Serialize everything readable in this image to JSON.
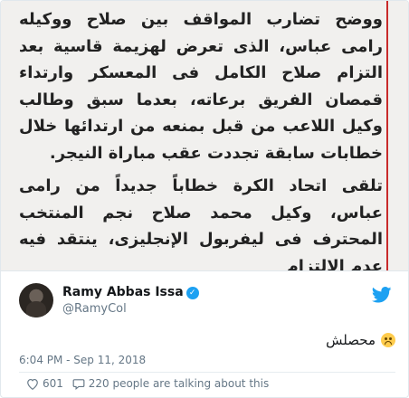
{
  "article": {
    "paragraphs": [
      "ووضح تضارب المواقف بين صلاح ووكيله رامى عباس، الذى تعرض لهزيمة قاسية بعد التزام صلاح الكامل فى المعسكر وارتداء قمصان الفريق برعاته، بعدما سبق وطالب وكيل اللاعب من قبل بمنعه من ارتدائها خلال خطابات سابقة تجددت عقب مباراة النيجر.",
      "تلقى اتحاد الكرة خطاباً جديداً من رامى عباس، وكيل محمد صلاح نجم المنتخب المحترف فى ليفربول الإنجليزى، ينتقد فيه عدم الالتزام"
    ]
  },
  "author": {
    "name": "Ramy Abbas Issa",
    "handle": "@RamyCol",
    "verified_icon": "verified-badge-icon"
  },
  "tweet": {
    "text": "محصلش",
    "emoji": "upside-down-face-icon",
    "timestamp": "6:04 PM - Sep 11, 2018"
  },
  "actions": {
    "likes": "601",
    "talking": "220 people are talking about this"
  },
  "colors": {
    "twitter_blue": "#1da1f2",
    "text": "#14171a",
    "muted": "#657786",
    "article_rule": "#c92a2a"
  }
}
